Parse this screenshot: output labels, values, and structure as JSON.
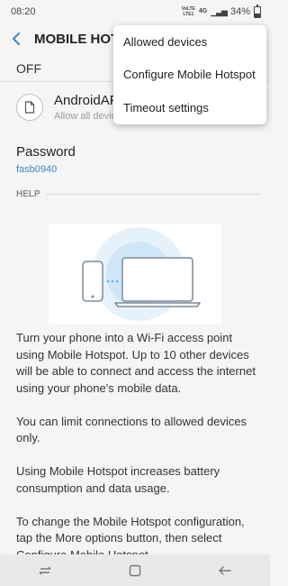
{
  "status_bar": {
    "time": "08:20",
    "network_top": "VoLTE",
    "network_mid": "4G",
    "network_bottom": "LTE1",
    "battery_text": "34%",
    "battery_level": 0.34
  },
  "app_bar": {
    "title": "MOBILE HOTSPOT",
    "back_icon": "back-arrow-icon"
  },
  "master_switch": {
    "label": "OFF"
  },
  "device": {
    "name": "AndroidAP",
    "subtitle": "Allow all devices"
  },
  "password": {
    "label": "Password",
    "value": "fasb0940"
  },
  "help": {
    "header": "HELP",
    "paragraphs": [
      "Turn your phone into a Wi-Fi access point using Mobile Hotspot. Up to 10 other devices will be able to connect and access the internet using your phone's mobile data.",
      "You can limit connections to allowed devices only.",
      "Using Mobile Hotspot increases battery consumption and data usage.",
      "To change the Mobile Hotspot configuration, tap the More options button, then select Configure Mobile Hotspot."
    ]
  },
  "options_menu": {
    "items": [
      "Allowed devices",
      "Configure Mobile Hotspot",
      "Timeout settings"
    ]
  },
  "nav_bar": {
    "icons": [
      "recents-icon",
      "home-icon",
      "back-icon"
    ]
  },
  "colors": {
    "accent": "#3a86c6",
    "background": "#f5f5f5",
    "illustration_glow": "#cfe6f7"
  }
}
